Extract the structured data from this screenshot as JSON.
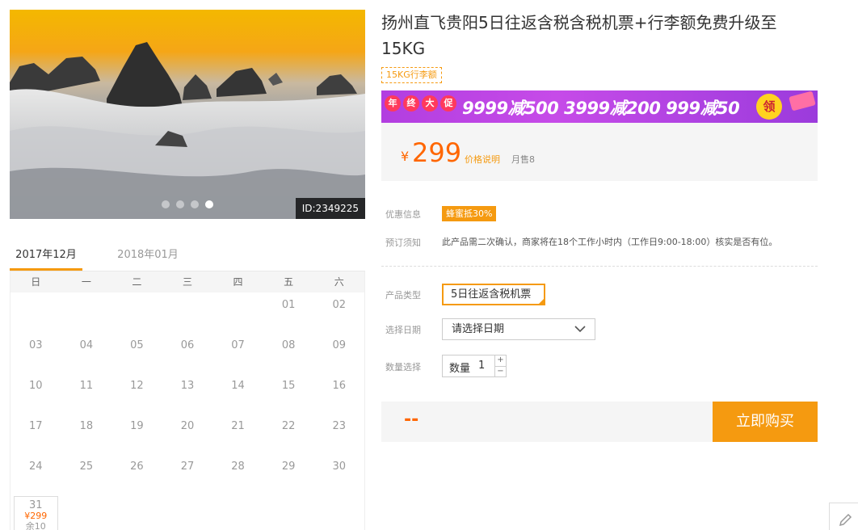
{
  "product": {
    "title": "扬州直飞贵阳5日往返含税含税机票+行李额免费升级至15KG",
    "tag": "15KG行李额",
    "image_id": "ID:2349225",
    "slides": 4,
    "active_slide": 4
  },
  "promo": {
    "badges": [
      "年",
      "终",
      "大",
      "促"
    ],
    "text": "9999减500  3999减200  999减50",
    "coin": "领"
  },
  "price": {
    "symbol": "¥",
    "value": "299",
    "explain_label": "价格说明",
    "monthly_sales": "月售8"
  },
  "info": {
    "discount_label": "优惠信息",
    "discount_badge": "蜂蜜抵30%",
    "notice_label": "预订须知",
    "notice_text": "此产品需二次确认，商家将在18个工作小时内（工作日9:00-18:00）核实是否有位。"
  },
  "options": {
    "type_label": "产品类型",
    "type_value": "5日往返含税机票",
    "date_label": "选择日期",
    "date_placeholder": "请选择日期",
    "qty_label": "数量选择",
    "qty_inner_label": "数量",
    "qty_value": "1",
    "plus": "+",
    "minus": "−"
  },
  "buy": {
    "total": "--",
    "button": "立即购买"
  },
  "calendar": {
    "tabs": [
      "2017年12月",
      "2018年01月"
    ],
    "weekdays": [
      "日",
      "一",
      "二",
      "三",
      "四",
      "五",
      "六"
    ],
    "weeks": [
      [
        "",
        "",
        "",
        "",
        "",
        "01",
        "02"
      ],
      [
        "03",
        "04",
        "05",
        "06",
        "07",
        "08",
        "09"
      ],
      [
        "10",
        "11",
        "12",
        "13",
        "14",
        "15",
        "16"
      ],
      [
        "17",
        "18",
        "19",
        "20",
        "21",
        "22",
        "23"
      ],
      [
        "24",
        "25",
        "26",
        "27",
        "28",
        "29",
        "30"
      ]
    ],
    "last_day": {
      "day": "31",
      "price": "¥299",
      "stock": "余10"
    }
  },
  "colors": {
    "accent": "#f59a10",
    "price": "#ff6600",
    "promo": "#b23ee0"
  },
  "icons": {
    "edit": "pencil-icon",
    "dropdown": "chevron-down-icon"
  }
}
